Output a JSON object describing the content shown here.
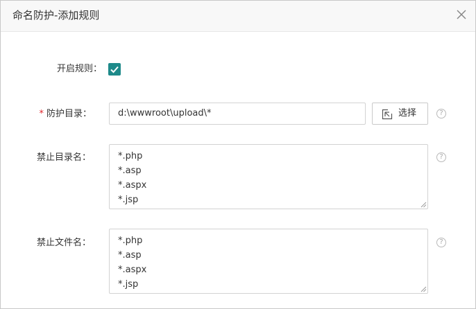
{
  "dialog": {
    "title": "命名防护-添加规则",
    "close_icon": "close-icon"
  },
  "form": {
    "enable_rule": {
      "label": "开启规则：",
      "checked": true
    },
    "protect_dir": {
      "required_mark": "*",
      "label": "防护目录：",
      "value": "d:\\wwwroot\\upload\\*",
      "select_button": {
        "label": "选择",
        "icon": "select-folder-icon"
      }
    },
    "forbid_dir_names": {
      "label": "禁止目录名：",
      "lines": [
        "*.php",
        "*.asp",
        "*.aspx",
        "*.jsp"
      ]
    },
    "forbid_file_names": {
      "label": "禁止文件名：",
      "lines": [
        "*.php",
        "*.asp",
        "*.aspx",
        "*.jsp"
      ]
    },
    "help_glyph": "?"
  },
  "colors": {
    "checkbox": "#1e8a8a",
    "required": "#e0252b",
    "header_bg": "#f8f8f8"
  }
}
